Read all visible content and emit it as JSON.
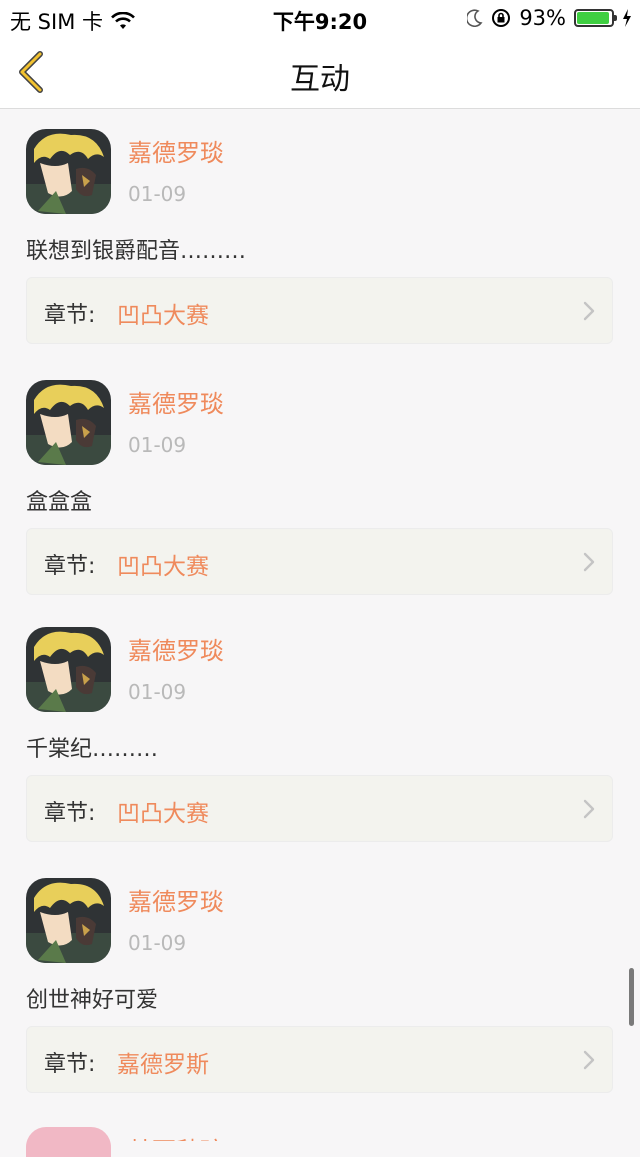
{
  "status_bar": {
    "carrier": "无 SIM 卡",
    "time": "下午9:20",
    "battery_percent": "93%",
    "battery_level": 0.93,
    "battery_color": "#3fcf41"
  },
  "nav": {
    "title": "互动",
    "back_icon": "chevron-left-icon",
    "accent": "#f2c230"
  },
  "comments": [
    {
      "name": "嘉德罗琰",
      "date": "01-09",
      "content": "联想到银爵配音………",
      "chapter_label": "章节:",
      "chapter": "凹凸大赛"
    },
    {
      "name": "嘉德罗琰",
      "date": "01-09",
      "content": "盒盒盒",
      "chapter_label": "章节:",
      "chapter": "凹凸大赛"
    },
    {
      "name": "嘉德罗琰",
      "date": "01-09",
      "content": "千棠纪………",
      "chapter_label": "章节:",
      "chapter": "凹凸大赛"
    },
    {
      "name": "嘉德罗琰",
      "date": "01-09",
      "content": "创世神好可爱",
      "chapter_label": "章节:",
      "chapter": "嘉德罗斯"
    }
  ],
  "partial_next": {
    "name": "某西秋琼"
  },
  "colors": {
    "name_color": "#ef8a5c",
    "date_color": "#b9b9b9",
    "card_bg": "#f3f3ee"
  }
}
